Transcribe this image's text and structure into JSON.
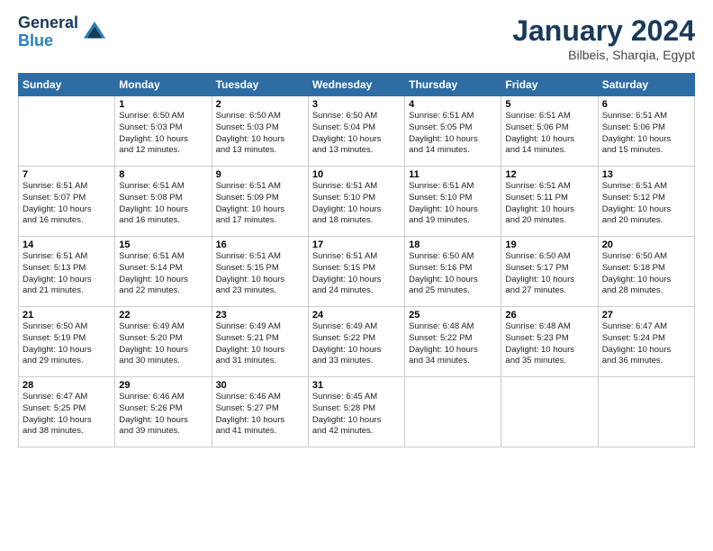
{
  "header": {
    "logo_line1": "General",
    "logo_line2": "Blue",
    "title": "January 2024",
    "subtitle": "Bilbeis, Sharqia, Egypt"
  },
  "columns": [
    "Sunday",
    "Monday",
    "Tuesday",
    "Wednesday",
    "Thursday",
    "Friday",
    "Saturday"
  ],
  "weeks": [
    [
      {
        "day": "",
        "info": ""
      },
      {
        "day": "1",
        "info": "Sunrise: 6:50 AM\nSunset: 5:03 PM\nDaylight: 10 hours\nand 12 minutes."
      },
      {
        "day": "2",
        "info": "Sunrise: 6:50 AM\nSunset: 5:03 PM\nDaylight: 10 hours\nand 13 minutes."
      },
      {
        "day": "3",
        "info": "Sunrise: 6:50 AM\nSunset: 5:04 PM\nDaylight: 10 hours\nand 13 minutes."
      },
      {
        "day": "4",
        "info": "Sunrise: 6:51 AM\nSunset: 5:05 PM\nDaylight: 10 hours\nand 14 minutes."
      },
      {
        "day": "5",
        "info": "Sunrise: 6:51 AM\nSunset: 5:06 PM\nDaylight: 10 hours\nand 14 minutes."
      },
      {
        "day": "6",
        "info": "Sunrise: 6:51 AM\nSunset: 5:06 PM\nDaylight: 10 hours\nand 15 minutes."
      }
    ],
    [
      {
        "day": "7",
        "info": "Sunrise: 6:51 AM\nSunset: 5:07 PM\nDaylight: 10 hours\nand 16 minutes."
      },
      {
        "day": "8",
        "info": "Sunrise: 6:51 AM\nSunset: 5:08 PM\nDaylight: 10 hours\nand 16 minutes."
      },
      {
        "day": "9",
        "info": "Sunrise: 6:51 AM\nSunset: 5:09 PM\nDaylight: 10 hours\nand 17 minutes."
      },
      {
        "day": "10",
        "info": "Sunrise: 6:51 AM\nSunset: 5:10 PM\nDaylight: 10 hours\nand 18 minutes."
      },
      {
        "day": "11",
        "info": "Sunrise: 6:51 AM\nSunset: 5:10 PM\nDaylight: 10 hours\nand 19 minutes."
      },
      {
        "day": "12",
        "info": "Sunrise: 6:51 AM\nSunset: 5:11 PM\nDaylight: 10 hours\nand 20 minutes."
      },
      {
        "day": "13",
        "info": "Sunrise: 6:51 AM\nSunset: 5:12 PM\nDaylight: 10 hours\nand 20 minutes."
      }
    ],
    [
      {
        "day": "14",
        "info": "Sunrise: 6:51 AM\nSunset: 5:13 PM\nDaylight: 10 hours\nand 21 minutes."
      },
      {
        "day": "15",
        "info": "Sunrise: 6:51 AM\nSunset: 5:14 PM\nDaylight: 10 hours\nand 22 minutes."
      },
      {
        "day": "16",
        "info": "Sunrise: 6:51 AM\nSunset: 5:15 PM\nDaylight: 10 hours\nand 23 minutes."
      },
      {
        "day": "17",
        "info": "Sunrise: 6:51 AM\nSunset: 5:15 PM\nDaylight: 10 hours\nand 24 minutes."
      },
      {
        "day": "18",
        "info": "Sunrise: 6:50 AM\nSunset: 5:16 PM\nDaylight: 10 hours\nand 25 minutes."
      },
      {
        "day": "19",
        "info": "Sunrise: 6:50 AM\nSunset: 5:17 PM\nDaylight: 10 hours\nand 27 minutes."
      },
      {
        "day": "20",
        "info": "Sunrise: 6:50 AM\nSunset: 5:18 PM\nDaylight: 10 hours\nand 28 minutes."
      }
    ],
    [
      {
        "day": "21",
        "info": "Sunrise: 6:50 AM\nSunset: 5:19 PM\nDaylight: 10 hours\nand 29 minutes."
      },
      {
        "day": "22",
        "info": "Sunrise: 6:49 AM\nSunset: 5:20 PM\nDaylight: 10 hours\nand 30 minutes."
      },
      {
        "day": "23",
        "info": "Sunrise: 6:49 AM\nSunset: 5:21 PM\nDaylight: 10 hours\nand 31 minutes."
      },
      {
        "day": "24",
        "info": "Sunrise: 6:49 AM\nSunset: 5:22 PM\nDaylight: 10 hours\nand 33 minutes."
      },
      {
        "day": "25",
        "info": "Sunrise: 6:48 AM\nSunset: 5:22 PM\nDaylight: 10 hours\nand 34 minutes."
      },
      {
        "day": "26",
        "info": "Sunrise: 6:48 AM\nSunset: 5:23 PM\nDaylight: 10 hours\nand 35 minutes."
      },
      {
        "day": "27",
        "info": "Sunrise: 6:47 AM\nSunset: 5:24 PM\nDaylight: 10 hours\nand 36 minutes."
      }
    ],
    [
      {
        "day": "28",
        "info": "Sunrise: 6:47 AM\nSunset: 5:25 PM\nDaylight: 10 hours\nand 38 minutes."
      },
      {
        "day": "29",
        "info": "Sunrise: 6:46 AM\nSunset: 5:26 PM\nDaylight: 10 hours\nand 39 minutes."
      },
      {
        "day": "30",
        "info": "Sunrise: 6:46 AM\nSunset: 5:27 PM\nDaylight: 10 hours\nand 41 minutes."
      },
      {
        "day": "31",
        "info": "Sunrise: 6:45 AM\nSunset: 5:28 PM\nDaylight: 10 hours\nand 42 minutes."
      },
      {
        "day": "",
        "info": ""
      },
      {
        "day": "",
        "info": ""
      },
      {
        "day": "",
        "info": ""
      }
    ]
  ]
}
